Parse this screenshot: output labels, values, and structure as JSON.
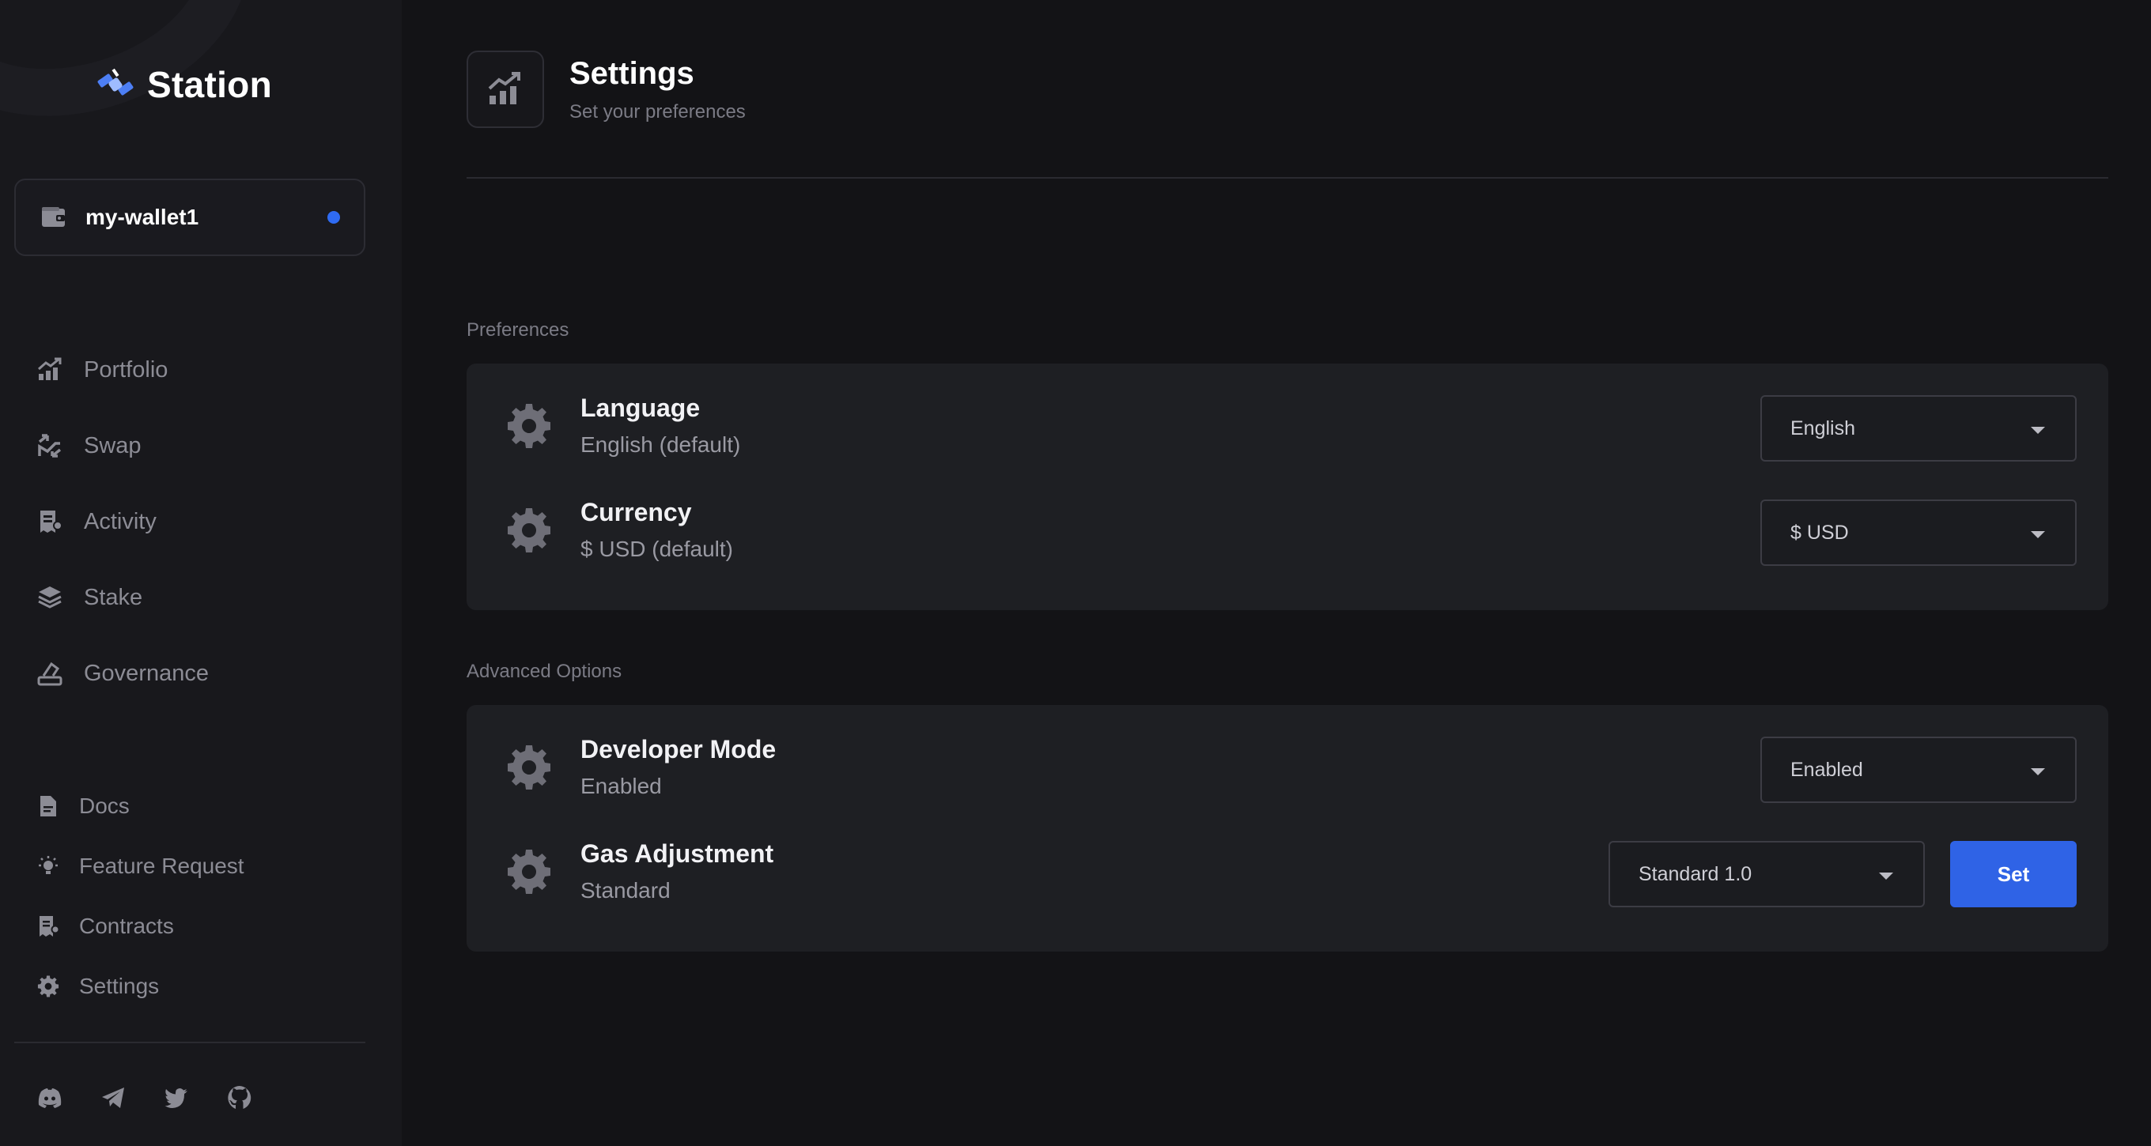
{
  "app": {
    "brand": "Station"
  },
  "wallet": {
    "name": "my-wallet1",
    "status_color": "#2f6bf2"
  },
  "nav": {
    "items": [
      {
        "label": "Portfolio",
        "icon": "chart-icon"
      },
      {
        "label": "Swap",
        "icon": "swap-icon"
      },
      {
        "label": "Activity",
        "icon": "receipt-icon"
      },
      {
        "label": "Stake",
        "icon": "layers-icon"
      },
      {
        "label": "Governance",
        "icon": "vote-icon"
      }
    ],
    "secondary": [
      {
        "label": "Docs",
        "icon": "doc-icon"
      },
      {
        "label": "Feature Request",
        "icon": "lightbulb-icon"
      },
      {
        "label": "Contracts",
        "icon": "receipt-icon"
      },
      {
        "label": "Settings",
        "icon": "gear-icon"
      }
    ],
    "socials": [
      "discord-icon",
      "telegram-icon",
      "twitter-icon",
      "github-icon"
    ]
  },
  "header": {
    "title": "Settings",
    "subtitle": "Set your preferences"
  },
  "preferences": {
    "label": "Preferences",
    "rows": [
      {
        "title": "Language",
        "value": "English (default)",
        "select": "English"
      },
      {
        "title": "Currency",
        "value": "$ USD (default)",
        "select": "$ USD"
      }
    ]
  },
  "advanced": {
    "label": "Advanced Options",
    "rows": [
      {
        "title": "Developer Mode",
        "value": "Enabled",
        "select": "Enabled"
      },
      {
        "title": "Gas Adjustment",
        "value": "Standard",
        "select": "Standard 1.0",
        "button": "Set"
      }
    ]
  },
  "colors": {
    "accent": "#2f63e6",
    "background": "#131316",
    "sidebar": "#18181c",
    "card": "#1e1f23"
  }
}
